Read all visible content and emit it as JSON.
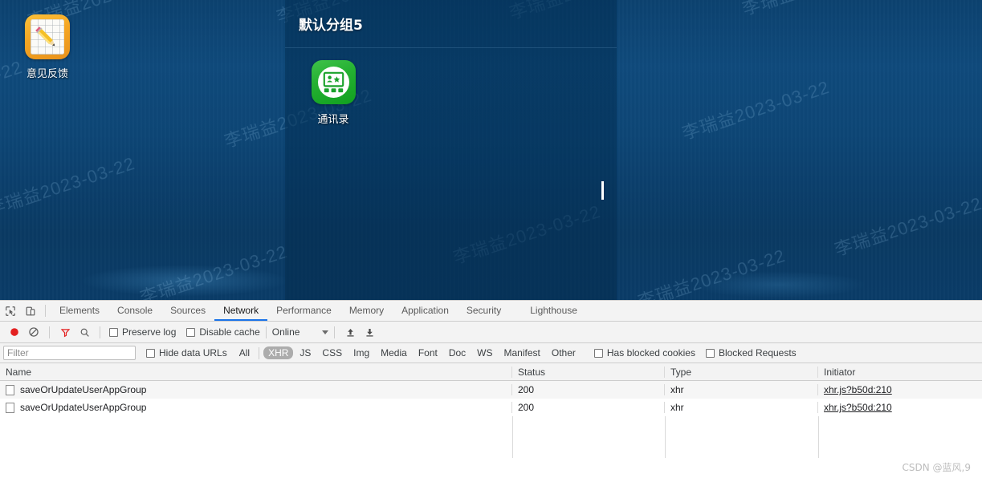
{
  "desktop": {
    "shortcut": {
      "label": "意见反馈",
      "icon": "notepad-pencil-icon"
    },
    "watermark_text": "李瑞益2023-03-22",
    "app_panel": {
      "title": "默认分组5",
      "apps": [
        {
          "label": "通讯录",
          "icon": "contacts-icon",
          "color": "#25b132"
        }
      ]
    }
  },
  "devtools": {
    "toolbar_icons": [
      {
        "name": "inspect-element-icon"
      },
      {
        "name": "device-toolbar-icon"
      }
    ],
    "tabs": [
      {
        "label": "Elements",
        "active": false
      },
      {
        "label": "Console",
        "active": false
      },
      {
        "label": "Sources",
        "active": false
      },
      {
        "label": "Network",
        "active": true
      },
      {
        "label": "Performance",
        "active": false
      },
      {
        "label": "Memory",
        "active": false
      },
      {
        "label": "Application",
        "active": false
      },
      {
        "label": "Security",
        "active": false
      },
      {
        "label": "Lighthouse",
        "active": false
      }
    ],
    "active_tab_accent": "#1a73e8",
    "controls": {
      "record_label": "Record network log",
      "clear_label": "Clear",
      "filter_icon_label": "Filter",
      "search_icon_label": "Search",
      "preserve_log": "Preserve log",
      "preserve_log_checked": false,
      "disable_cache": "Disable cache",
      "disable_cache_checked": false,
      "throttling": "Online",
      "import_har_label": "Import HAR",
      "export_har_label": "Export HAR"
    },
    "filterbar": {
      "filter_placeholder": "Filter",
      "filter_value": "",
      "hide_data_urls": "Hide data URLs",
      "hide_data_urls_checked": false,
      "types": [
        {
          "label": "All",
          "active": false
        },
        {
          "label": "XHR",
          "active": true
        },
        {
          "label": "JS",
          "active": false
        },
        {
          "label": "CSS",
          "active": false
        },
        {
          "label": "Img",
          "active": false
        },
        {
          "label": "Media",
          "active": false
        },
        {
          "label": "Font",
          "active": false
        },
        {
          "label": "Doc",
          "active": false
        },
        {
          "label": "WS",
          "active": false
        },
        {
          "label": "Manifest",
          "active": false
        },
        {
          "label": "Other",
          "active": false
        }
      ],
      "has_blocked_cookies": "Has blocked cookies",
      "has_blocked_cookies_checked": false,
      "blocked_requests": "Blocked Requests",
      "blocked_requests_checked": false
    },
    "table": {
      "columns": [
        "Name",
        "Status",
        "Type",
        "Initiator"
      ],
      "rows": [
        {
          "name": "saveOrUpdateUserAppGroup",
          "status": "200",
          "type": "xhr",
          "initiator": "xhr.js?b50d:210"
        },
        {
          "name": "saveOrUpdateUserAppGroup",
          "status": "200",
          "type": "xhr",
          "initiator": "xhr.js?b50d:210"
        }
      ]
    }
  },
  "page_watermark": "CSDN @蓝风,9"
}
